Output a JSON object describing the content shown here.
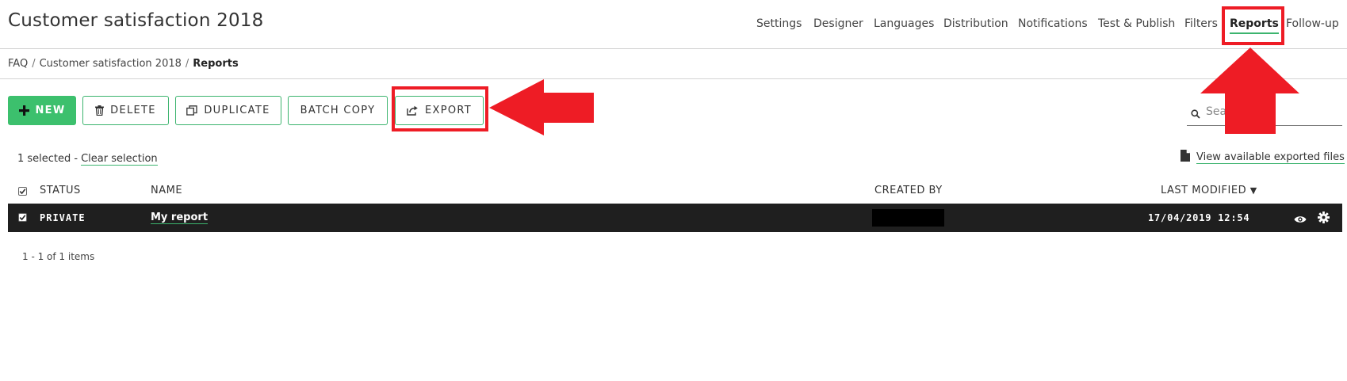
{
  "app": {
    "title": "Customer satisfaction 2018"
  },
  "nav": {
    "items": [
      {
        "label": "Settings",
        "active": false
      },
      {
        "label": "Designer",
        "active": false
      },
      {
        "label": "Languages",
        "active": false
      },
      {
        "label": "Distribution",
        "active": false
      },
      {
        "label": "Notifications",
        "active": false
      },
      {
        "label": "Test & Publish",
        "active": false
      },
      {
        "label": "Filters",
        "active": false
      },
      {
        "label": "Reports",
        "active": true
      },
      {
        "label": "Follow-up",
        "active": false
      }
    ]
  },
  "breadcrumb": {
    "items": [
      "FAQ",
      "Customer satisfaction 2018"
    ],
    "current": "Reports"
  },
  "toolbar": {
    "new_label": "NEW",
    "delete_label": "DELETE",
    "duplicate_label": "DUPLICATE",
    "batch_copy_label": "BATCH COPY",
    "export_label": "EXPORT"
  },
  "search": {
    "placeholder": "Search",
    "icon": "search-icon"
  },
  "selection": {
    "count_text": "1 selected -",
    "clear_label": "Clear selection"
  },
  "exported_files": {
    "label": "View available exported files",
    "icon": "file-icon"
  },
  "table": {
    "columns": {
      "status": "STATUS",
      "name": "NAME",
      "created_by": "CREATED BY",
      "last_modified": "LAST MODIFIED"
    },
    "sort_indicator": "▼",
    "rows": [
      {
        "selected": true,
        "status": "PRIVATE",
        "name": "My report",
        "created_by": "",
        "last_modified": "17/04/2019 12:54"
      }
    ]
  },
  "pager": {
    "text": "1 - 1 of 1 items"
  },
  "colors": {
    "accent": "#3cb46e",
    "primary_button": "#3cc06d",
    "row_selected_bg": "#1f1f1f",
    "annotation_red": "#ee1c25"
  }
}
